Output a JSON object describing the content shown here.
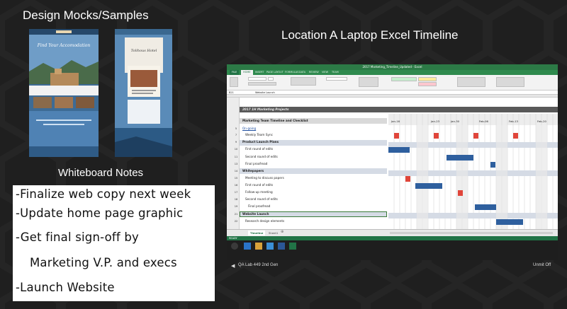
{
  "titles": {
    "mocks": "Design Mocks/Samples",
    "laptop": "Location A Laptop Excel Timeline",
    "whiteboard": "Whiteboard Notes"
  },
  "mocks": {
    "left": {
      "headline": "Find Your Accomodation"
    },
    "right": {
      "headline": "Tolihous Hotel"
    }
  },
  "whiteboard": {
    "lines": [
      "-Finalize web copy next week",
      "-Update home page graphic",
      "-Get final sign-off  by",
      "Marketing V.P. and execs",
      "-Launch Website"
    ]
  },
  "excel": {
    "window_title": "2017 Marketing_Timeline_Updated - Excel",
    "tabs": [
      "FILE",
      "HOME",
      "INSERT",
      "PAGE LAYOUT",
      "FORMULAS",
      "DATA",
      "REVIEW",
      "VIEW",
      "TEAM"
    ],
    "name_box": "B21",
    "formula_value": "Website Launch",
    "sheet_title": "2017 1H Marketing Projects",
    "subtitle": "Marketing Team Timeline and Checklist",
    "months": [
      "Jan-16",
      "Jan-23",
      "Jan-30",
      "Feb-06",
      "Feb-13",
      "Feb-20"
    ],
    "rows": [
      {
        "num": "5",
        "label": "On-going",
        "kind": "section-link"
      },
      {
        "num": "7",
        "label": "Weekly Team Sync",
        "kind": "task"
      },
      {
        "num": "9",
        "label": "Product Launch Plans",
        "kind": "header"
      },
      {
        "num": "10",
        "label": "First round of edits",
        "kind": "task"
      },
      {
        "num": "11",
        "label": "Second round of edits",
        "kind": "task"
      },
      {
        "num": "13",
        "label": "Final proofread",
        "kind": "task"
      },
      {
        "num": "14",
        "label": "Whitepapers",
        "kind": "header"
      },
      {
        "num": "15",
        "label": "Meeting to discuss papers",
        "kind": "task"
      },
      {
        "num": "16",
        "label": "First round of edits",
        "kind": "task"
      },
      {
        "num": "17",
        "label": "Follow-up meeting",
        "kind": "task"
      },
      {
        "num": "18",
        "label": "Second round of edits",
        "kind": "task"
      },
      {
        "num": "19",
        "label": "Final proofread",
        "kind": "task"
      },
      {
        "num": "21",
        "label": "Website Launch",
        "kind": "header"
      },
      {
        "num": "22",
        "label": "Research design elements",
        "kind": "task"
      }
    ],
    "sheet_tabs": [
      "Timeline",
      "Sheet1"
    ],
    "status_text": "READY",
    "taskbar_label": "QA Lab 449 2nd Gen",
    "tray_label": "Unmit Off",
    "colors": {
      "excel_green": "#217346",
      "bar_blue": "#2e5f9e",
      "bar_red": "#e0453a",
      "header_band": "#d5dbe5"
    }
  }
}
